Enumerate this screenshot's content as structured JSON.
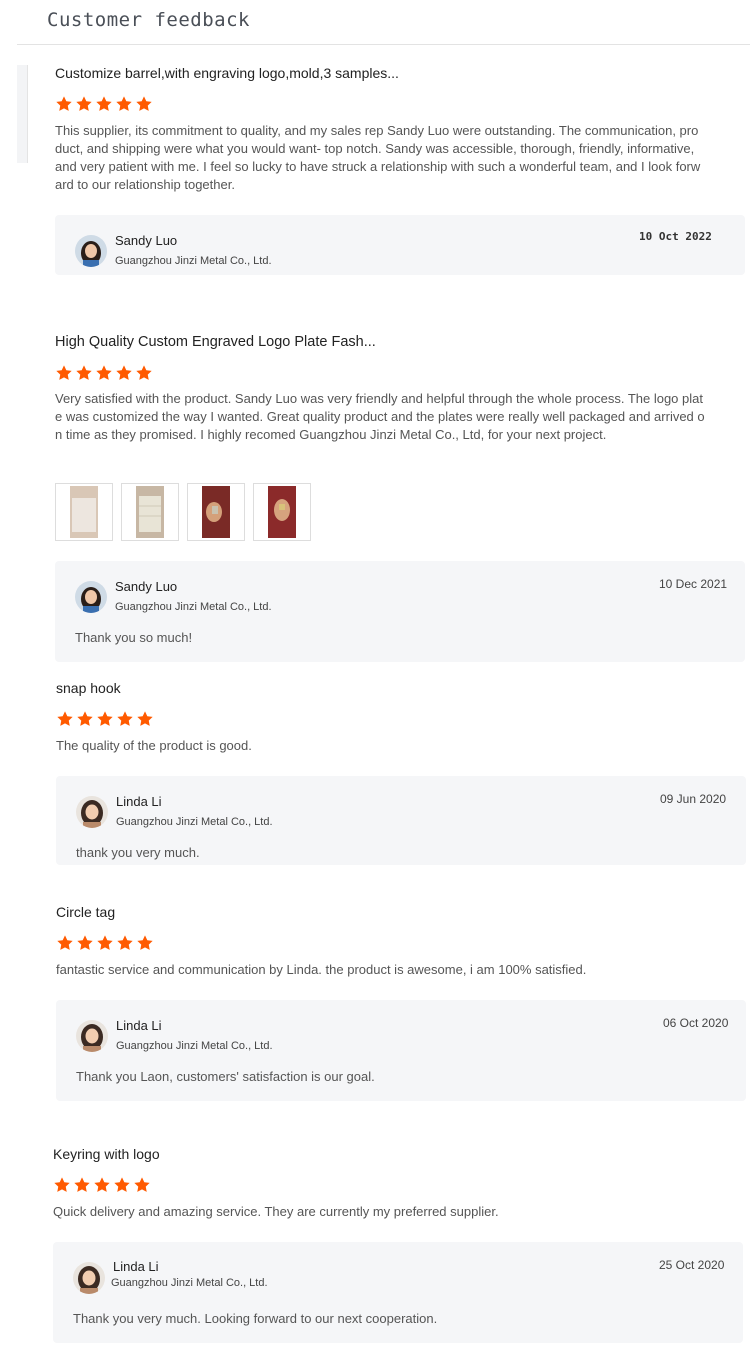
{
  "header": {
    "title": "Customer feedback"
  },
  "colors": {
    "star": "#ff5a00",
    "reply_bg": "#f5f6f8"
  },
  "reviews": [
    {
      "title": "Customize barrel,with engraving logo,mold,3 samples...",
      "rating": 5,
      "text": "This supplier, its commitment to quality, and my sales rep Sandy Luo were outstanding. The communication, product, and shipping were what you would want- top notch. Sandy was accessible, thorough, friendly, informative, and very patient with me. I feel so lucky to have struck a relationship with such a wonderful team, and I look forward to our relationship together.",
      "reply": {
        "name": "Sandy Luo",
        "company": "Guangzhou Jinzi Metal Co., Ltd.",
        "date": "10 Oct 2022",
        "text": ""
      }
    },
    {
      "title": "High Quality Custom Engraved Logo Plate Fash...",
      "rating": 5,
      "text": "Very satisfied with the product. Sandy Luo was very friendly and helpful through the whole process. The logo plate was customized the way I wanted. Great quality product and the plates were really well packaged and arrived on time as they promised. I highly recomed Guangzhou Jinzi Metal Co., Ltd, for your next project.",
      "photos": [
        "photo-1",
        "photo-2",
        "photo-3",
        "photo-4"
      ],
      "reply": {
        "name": "Sandy Luo",
        "company": "Guangzhou Jinzi Metal Co., Ltd.",
        "date": "10 Dec 2021",
        "text": "Thank you so much!"
      }
    },
    {
      "title": "snap hook",
      "rating": 5,
      "text": "The quality of the product is good.",
      "reply": {
        "name": "Linda Li",
        "company": "Guangzhou Jinzi Metal Co., Ltd.",
        "date": "09 Jun 2020",
        "text": "thank you very much."
      }
    },
    {
      "title": "Circle tag",
      "rating": 5,
      "text": "fantastic service and communication by Linda.  the product is awesome, i am 100% satisfied.",
      "reply": {
        "name": "Linda Li",
        "company": "Guangzhou Jinzi Metal Co., Ltd.",
        "date": "06 Oct 2020",
        "text": "Thank you Laon, customers' satisfaction is our goal."
      }
    },
    {
      "title": "Keyring with logo",
      "rating": 5,
      "text": "Quick delivery and amazing service. They are currently my preferred supplier.",
      "reply": {
        "name": "Linda Li",
        "company": "Guangzhou Jinzi Metal Co., Ltd.",
        "date": "25 Oct 2020",
        "text": "Thank you very much. Looking forward to our next cooperation."
      }
    }
  ]
}
